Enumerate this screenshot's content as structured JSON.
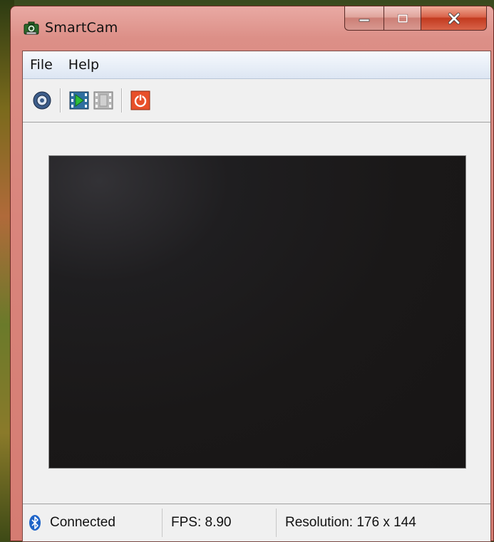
{
  "window": {
    "title": "SmartCam",
    "accent_color": "#d9857c",
    "caption_buttons": [
      "minimize-icon",
      "maximize-icon",
      "close-icon"
    ]
  },
  "menu": {
    "items": [
      {
        "label": "File"
      },
      {
        "label": "Help"
      }
    ]
  },
  "toolbar": {
    "buttons": [
      {
        "icon": "settings-disc-icon"
      },
      {
        "icon": "start-video-icon"
      },
      {
        "icon": "stop-video-icon"
      },
      {
        "icon": "power-icon"
      }
    ]
  },
  "video": {
    "background_color": "#1a1818"
  },
  "status": {
    "connection_icon": "bluetooth-icon",
    "connection": "Connected",
    "fps": "FPS: 8.90",
    "resolution": "Resolution: 176 x 144"
  }
}
